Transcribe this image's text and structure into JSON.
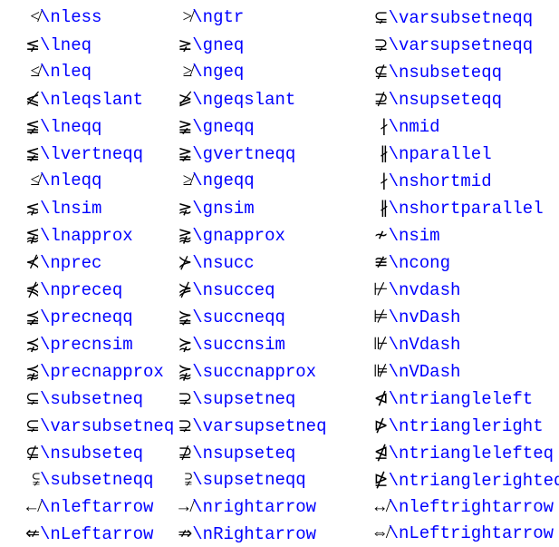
{
  "rows": [
    {
      "c1s": "≮",
      "c1c": "\\nless",
      "c2s": "≯",
      "c2c": "\\ngtr",
      "c3s": "⊊",
      "c3c": "\\varsubsetneqq"
    },
    {
      "c1s": "⪇",
      "c1c": "\\lneq",
      "c2s": "⪈",
      "c2c": "\\gneq",
      "c3s": "⊋",
      "c3c": "\\varsupsetneqq"
    },
    {
      "c1s": "≰",
      "c1c": "\\nleq",
      "c2s": "≱",
      "c2c": "\\ngeq",
      "c3s": "⊈",
      "c3c": "\\nsubseteqq"
    },
    {
      "c1s": "⩽̸",
      "c1c": "\\nleqslant",
      "c2s": "⩾̸",
      "c2c": "\\ngeqslant",
      "c3s": "⊉",
      "c3c": "\\nsupseteqq"
    },
    {
      "c1s": "≨",
      "c1c": "\\lneqq",
      "c2s": "≩",
      "c2c": "\\gneqq",
      "c3s": "∤",
      "c3c": "\\nmid"
    },
    {
      "c1s": "≨",
      "c1c": "\\lvertneqq",
      "c2s": "≩",
      "c2c": "\\gvertneqq",
      "c3s": "∦",
      "c3c": "\\nparallel"
    },
    {
      "c1s": "≰",
      "c1c": "\\nleqq",
      "c2s": "≱",
      "c2c": "\\ngeqq",
      "c3s": "∤",
      "c3c": "\\nshortmid"
    },
    {
      "c1s": "⋦",
      "c1c": "\\lnsim",
      "c2s": "⋧",
      "c2c": "\\gnsim",
      "c3s": "∦",
      "c3c": "\\nshortparallel"
    },
    {
      "c1s": "⪉",
      "c1c": "\\lnapprox",
      "c2s": "⪊",
      "c2c": "\\gnapprox",
      "c3s": "≁",
      "c3c": "\\nsim"
    },
    {
      "c1s": "⊀",
      "c1c": "\\nprec",
      "c2s": "⊁",
      "c2c": "\\nsucc",
      "c3s": "≇",
      "c3c": "\\ncong"
    },
    {
      "c1s": "⋠",
      "c1c": "\\npreceq",
      "c2s": "⋡",
      "c2c": "\\nsucceq",
      "c3s": "⊬",
      "c3c": "\\nvdash"
    },
    {
      "c1s": "⪵",
      "c1c": "\\precneqq",
      "c2s": "⪶",
      "c2c": "\\succneqq",
      "c3s": "⊭",
      "c3c": "\\nvDash"
    },
    {
      "c1s": "⋨",
      "c1c": "\\precnsim",
      "c2s": "⋩",
      "c2c": "\\succnsim",
      "c3s": "⊮",
      "c3c": "\\nVdash"
    },
    {
      "c1s": "⪹",
      "c1c": "\\precnapprox",
      "c2s": "⪺",
      "c2c": "\\succnapprox",
      "c3s": "⊯",
      "c3c": "\\nVDash"
    },
    {
      "c1s": "⊊",
      "c1c": "\\subsetneq",
      "c2s": "⊋",
      "c2c": "\\supsetneq",
      "c3s": "⋪",
      "c3c": "\\ntriangleleft"
    },
    {
      "c1s": "⊊",
      "c1c": "\\varsubsetneq",
      "c2s": "⊋",
      "c2c": "\\varsupsetneq",
      "c3s": "⋫",
      "c3c": "\\ntriangleright"
    },
    {
      "c1s": "⊈",
      "c1c": "\\nsubseteq",
      "c2s": "⊉",
      "c2c": "\\nsupseteq",
      "c3s": "⋬",
      "c3c": "\\ntrianglelefteq"
    },
    {
      "c1s": "⫋",
      "c1c": "\\subsetneqq",
      "c2s": "⫌",
      "c2c": "\\supsetneqq",
      "c3s": "⋭",
      "c3c": "\\ntrianglerighteq"
    },
    {
      "c1s": "↚",
      "c1c": "\\nleftarrow",
      "c2s": "↛",
      "c2c": "\\nrightarrow",
      "c3s": "↮",
      "c3c": "\\nleftrightarrow"
    },
    {
      "c1s": "⇍",
      "c1c": "\\nLeftarrow",
      "c2s": "⇏",
      "c2c": "\\nRightarrow",
      "c3s": "⇎",
      "c3c": "\\nLeftrightarrow"
    }
  ]
}
